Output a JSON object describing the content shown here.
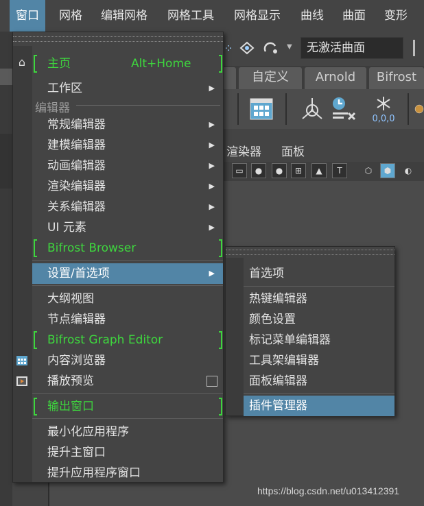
{
  "menubar": {
    "items": [
      "窗口",
      "网格",
      "编辑网格",
      "网格工具",
      "网格显示",
      "曲线",
      "曲面",
      "变形"
    ]
  },
  "toolbar": {
    "surface_field": "无激活曲面"
  },
  "shelf": {
    "tabs": [
      "自定义",
      "Arnold",
      "Bifrost"
    ],
    "counter_label": "0,0,0"
  },
  "panel": {
    "menus": [
      "渲染器",
      "面板"
    ]
  },
  "window_menu": {
    "home": {
      "label": "主页",
      "shortcut": "Alt+Home"
    },
    "workspace": "工作区",
    "editors_section": "编辑器",
    "editors": [
      "常规编辑器",
      "建模编辑器",
      "动画编辑器",
      "渲染编辑器",
      "关系编辑器",
      "UI 元素"
    ],
    "bifrost_browser": "Bifrost Browser",
    "settings": "设置/首选项",
    "outliner": "大纲视图",
    "node_editor": "节点编辑器",
    "bifrost_graph": "Bifrost Graph Editor",
    "content_browser": "内容浏览器",
    "playblast": "播放预览",
    "output_window": "输出窗口",
    "minimize": "最小化应用程序",
    "raise_main": "提升主窗口",
    "raise_app": "提升应用程序窗口"
  },
  "settings_submenu": {
    "items": [
      "首选项",
      "热键编辑器",
      "颜色设置",
      "标记菜单编辑器",
      "工具架编辑器",
      "面板编辑器",
      "插件管理器"
    ]
  },
  "watermark": "https://blog.csdn.net/u013412391",
  "colors": {
    "accent": "#5285a6",
    "highlight_green": "#3ed63e",
    "background": "#444444"
  }
}
